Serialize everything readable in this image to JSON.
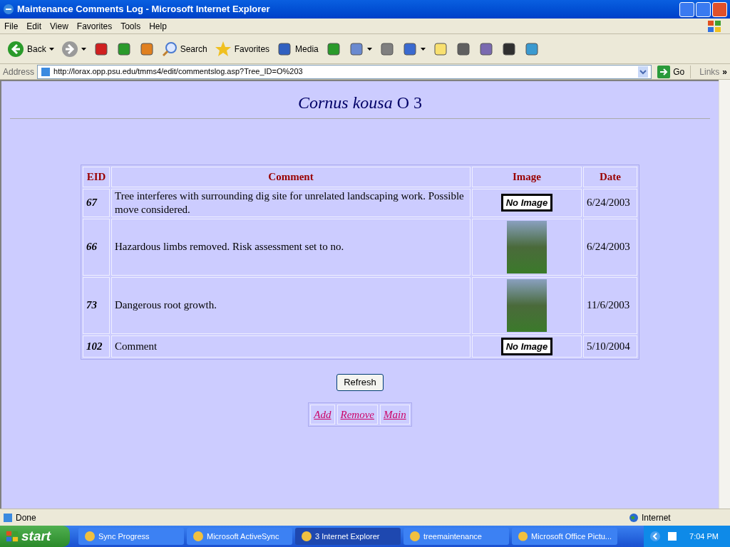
{
  "window": {
    "title": "Maintenance Comments Log - Microsoft Internet Explorer"
  },
  "menu": [
    "File",
    "Edit",
    "View",
    "Favorites",
    "Tools",
    "Help"
  ],
  "toolbar": [
    {
      "kind": "split",
      "label": "Back"
    },
    {
      "kind": "split"
    },
    {
      "kind": "plain"
    },
    {
      "kind": "plain"
    },
    {
      "kind": "plain"
    },
    {
      "kind": "plain",
      "label": "Search"
    },
    {
      "kind": "plain",
      "label": "Favorites"
    },
    {
      "kind": "plain",
      "label": "Media"
    },
    {
      "kind": "plain"
    },
    {
      "kind": "split"
    },
    {
      "kind": "plain"
    },
    {
      "kind": "split"
    },
    {
      "kind": "plain"
    },
    {
      "kind": "plain"
    },
    {
      "kind": "plain"
    },
    {
      "kind": "plain"
    },
    {
      "kind": "plain"
    }
  ],
  "address": {
    "label": "Address",
    "value": "http://lorax.opp.psu.edu/tmms4/edit/commentslog.asp?Tree_ID=O%203",
    "go": "Go",
    "links": "Links",
    "more": "»"
  },
  "page": {
    "title_italic": "Cornus kousa",
    "title_rest": "O 3",
    "table": {
      "columns": [
        "EID",
        "Comment",
        "Image",
        "Date"
      ],
      "rows": [
        {
          "eid": "67",
          "comment": "Tree interferes with surrounding dig site for unrelated landscaping work. Possible move considered.",
          "image": {
            "kind": "none",
            "label": "No Image"
          },
          "date": "6/24/2003"
        },
        {
          "eid": "66",
          "comment": "Hazardous limbs removed. Risk assessment set to no.",
          "image": {
            "kind": "photo"
          },
          "date": "6/24/2003"
        },
        {
          "eid": "73",
          "comment": "Dangerous root growth.",
          "image": {
            "kind": "photo"
          },
          "date": "11/6/2003"
        },
        {
          "eid": "102",
          "comment": "Comment",
          "image": {
            "kind": "none",
            "label": "No Image"
          },
          "date": "5/10/2004"
        }
      ]
    },
    "refresh": "Refresh",
    "links": [
      "Add",
      "Remove",
      "Main"
    ]
  },
  "status_bar": {
    "text": "Done",
    "zone": "Internet"
  },
  "taskbar": {
    "start": "start",
    "tasks": [
      {
        "label": "Sync Progress",
        "selected": false
      },
      {
        "label": "Microsoft ActiveSync",
        "selected": false
      },
      {
        "label": "3 Internet Explorer",
        "selected": true
      },
      {
        "label": "treemaintenance",
        "selected": false
      },
      {
        "label": "Microsoft Office Pictu...",
        "selected": false
      }
    ],
    "clock": "7:04 PM"
  }
}
